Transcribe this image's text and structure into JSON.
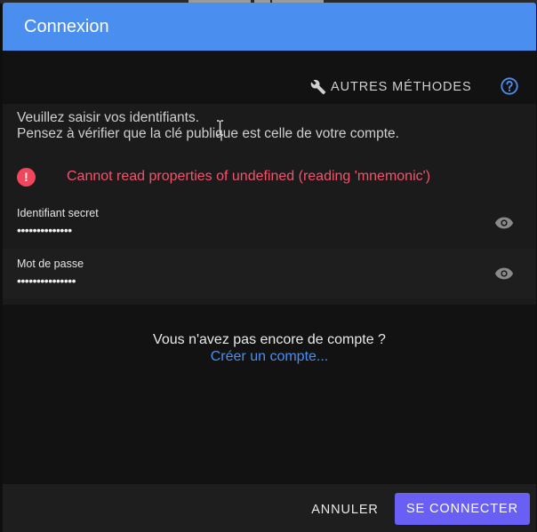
{
  "dialog": {
    "title": "Connexion"
  },
  "toolbar": {
    "other_methods_label": "AUTRES MÉTHODES",
    "help_icon": "help-circle-icon"
  },
  "instructions": {
    "line1": "Veuillez saisir vos identifiants.",
    "line2": "Pensez à vérifier que la clé publique est celle de votre compte."
  },
  "error": {
    "icon": "!",
    "message": "Cannot read properties of undefined (reading 'mnemonic')"
  },
  "fields": [
    {
      "label": "Identifiant secret",
      "value": "••••••••••••••"
    },
    {
      "label": "Mot de passe",
      "value": "•••••••••••••••"
    }
  ],
  "signup": {
    "question": "Vous n'avez pas encore de compte ?",
    "link": "Créer un compte..."
  },
  "footer": {
    "cancel_label": "ANNULER",
    "connect_label": "SE CONNECTER"
  },
  "colors": {
    "header": "#4a8ff0",
    "error": "#f4526a",
    "primary_button": "#6a5ff5",
    "link": "#4a8ff0"
  }
}
